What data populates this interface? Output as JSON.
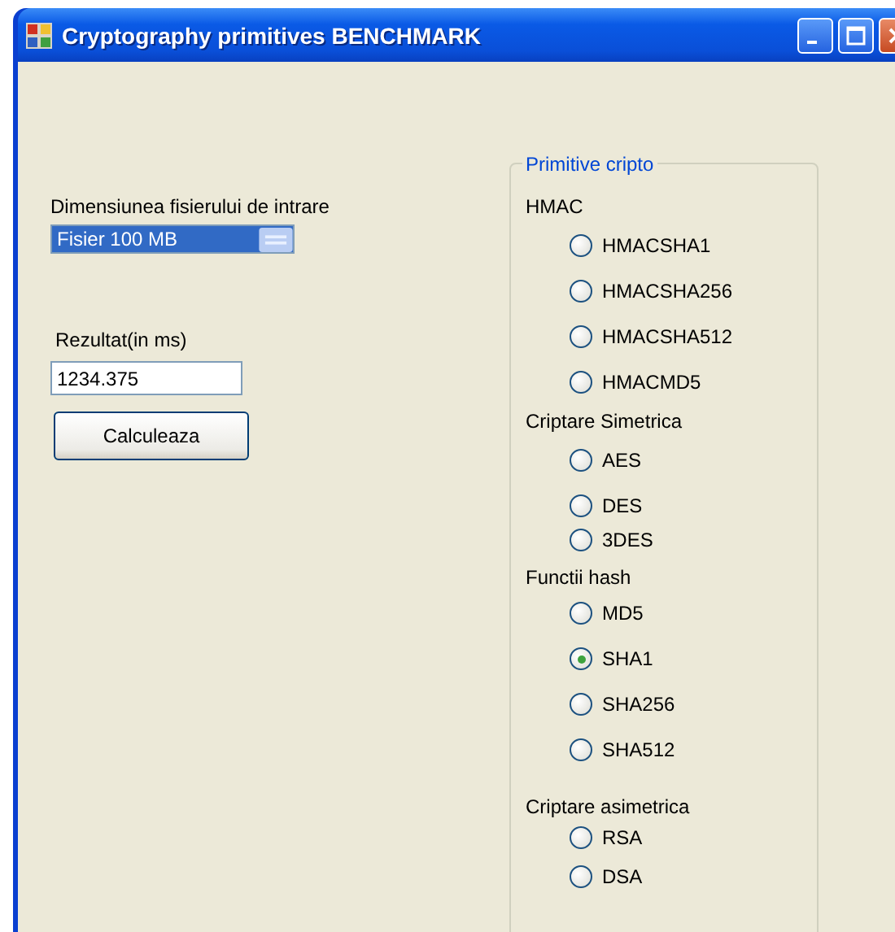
{
  "window": {
    "title": "Cryptography primitives BENCHMARK"
  },
  "file_size": {
    "label": "Dimensiunea fisierului de intrare",
    "value": "Fisier 100 MB"
  },
  "result": {
    "label": "Rezultat(in ms)",
    "value": "1234.375"
  },
  "calculate_button": "Calculeaza",
  "primitives": {
    "title": "Primitive cripto",
    "groups": [
      {
        "heading": "HMAC",
        "options": [
          {
            "label": "HMACSHA1",
            "selected": false
          },
          {
            "label": "HMACSHA256",
            "selected": false
          },
          {
            "label": "HMACSHA512",
            "selected": false
          },
          {
            "label": "HMACMD5",
            "selected": false
          }
        ]
      },
      {
        "heading": "Criptare Simetrica",
        "options": [
          {
            "label": "AES",
            "selected": false
          },
          {
            "label": "DES",
            "selected": false
          },
          {
            "label": "3DES",
            "selected": false
          }
        ]
      },
      {
        "heading": "Functii hash",
        "options": [
          {
            "label": "MD5",
            "selected": false
          },
          {
            "label": "SHA1",
            "selected": true
          },
          {
            "label": "SHA256",
            "selected": false
          },
          {
            "label": "SHA512",
            "selected": false
          }
        ]
      },
      {
        "heading": "Criptare asimetrica",
        "options": [
          {
            "label": "RSA",
            "selected": false
          },
          {
            "label": "DSA",
            "selected": false
          }
        ]
      }
    ]
  }
}
